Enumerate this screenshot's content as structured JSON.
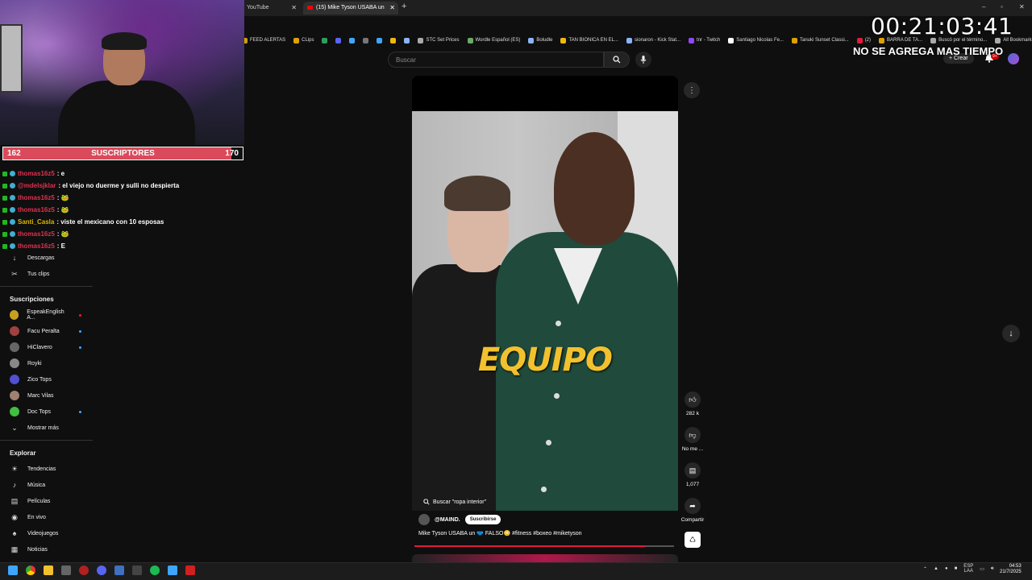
{
  "browser": {
    "tabs": [
      {
        "label": "YouTube"
      },
      {
        "label": "(15) Mike Tyson USABA un"
      }
    ],
    "bookmarks": [
      {
        "label": "FEED ALERTAS",
        "color": "#d0a000"
      },
      {
        "label": "CLips",
        "color": "#e0a000"
      },
      {
        "label": "",
        "color": "#2aa05a"
      },
      {
        "label": "",
        "color": "#5865f2"
      },
      {
        "label": "",
        "color": "#3ea6ff"
      },
      {
        "label": "",
        "color": "#777"
      },
      {
        "label": "",
        "color": "#3ea6ff"
      },
      {
        "label": "",
        "color": "#f0b90b"
      },
      {
        "label": "",
        "color": "#8ab4f8"
      },
      {
        "label": "STC Set Prices",
        "color": "#aaa"
      },
      {
        "label": "Wordle Español (ES)",
        "color": "#6aaa64"
      },
      {
        "label": "Boludle",
        "color": "#8ab4f8"
      },
      {
        "label": "TAN BIONICA EN EL...",
        "color": "#f0b90b"
      },
      {
        "label": "sionaron - Kick Stat...",
        "color": "#8ab4f8"
      },
      {
        "label": "tnr - Twitch",
        "color": "#9146ff"
      },
      {
        "label": "Santiago Nicolas Fe...",
        "color": "#fff"
      },
      {
        "label": "Tanuki Sunset Classi...",
        "color": "#e0a000"
      },
      {
        "label": "(2)",
        "color": "#e21b3c"
      },
      {
        "label": "BARRA DE TA...",
        "color": "#e0a000"
      },
      {
        "label": "Buscó por el término...",
        "color": "#aaa"
      },
      {
        "label": "All Bookmarks",
        "color": "#aaa"
      }
    ]
  },
  "overlay": {
    "timer": "00:21:03:41",
    "timer_note": "NO SE AGREGA MAS TIEMPO",
    "sub_bar": {
      "current": "162",
      "label": "SUSCRIPTORES",
      "goal": "170",
      "progress_fraction": 0.953
    },
    "chat": [
      {
        "user": "thomas16z5",
        "msg": ": e",
        "color": "red"
      },
      {
        "user": "@mdelsjklar",
        "msg": ": el viejo no duerme y sulli no despierta",
        "color": "red"
      },
      {
        "user": "thomas16z5",
        "msg": ": 🐸",
        "color": "red"
      },
      {
        "user": "thomas16z5",
        "msg": ": 🐸",
        "color": "red"
      },
      {
        "user": "Santi_Casla",
        "msg": ": viste el mexicano con 10 esposas",
        "color": "yellow"
      },
      {
        "user": "thomas16z5",
        "msg": ": 🐸",
        "color": "red"
      },
      {
        "user": "thomas16z5",
        "msg": ": E",
        "color": "red"
      }
    ]
  },
  "youtube": {
    "search_placeholder": "Buscar",
    "create_label": "Crear",
    "notif_count": "9+",
    "sidebar": {
      "top_items": [
        {
          "label": "Descargas",
          "icon": "↓"
        },
        {
          "label": "Tus clips",
          "icon": "✂"
        }
      ],
      "subs_heading": "Suscripciones",
      "subscriptions": [
        {
          "label": "EspeakEnglish A...",
          "color": "#c8a020",
          "live": true
        },
        {
          "label": "Facu Peralta",
          "color": "#a04040",
          "dot": true
        },
        {
          "label": "HiClavero",
          "color": "#666",
          "dot": true
        },
        {
          "label": "Royki",
          "color": "#888",
          "dot": false
        },
        {
          "label": "Zico Tops",
          "color": "#5050d0",
          "dot": false
        },
        {
          "label": "Marc Vilas",
          "color": "#a08070",
          "dot": false
        },
        {
          "label": "Doc Tops",
          "color": "#40c040",
          "dot": true
        }
      ],
      "show_more": "Mostrar más",
      "explore_heading": "Explorar",
      "explore": [
        {
          "label": "Tendencias",
          "icon": "☀"
        },
        {
          "label": "Música",
          "icon": "♪"
        },
        {
          "label": "Películas",
          "icon": "▤"
        },
        {
          "label": "En vivo",
          "icon": "◉"
        },
        {
          "label": "Videojuegos",
          "icon": "♠"
        },
        {
          "label": "Noticias",
          "icon": "▦"
        },
        {
          "label": "Deportes",
          "icon": "♣"
        }
      ]
    },
    "short": {
      "caption_overlay": "EQUIPO",
      "search_suggestion": "Buscar \"ropa interior\"",
      "channel": "@MAIND.",
      "subscribe_label": "Suscribirse",
      "title": "Mike Tyson USABA un 🩲 FALSO😳 #fitness #boxeo #miketyson",
      "progress_fraction": 0.89,
      "likes": "282 k",
      "dislike_label": "No me ...",
      "comments": "1,077",
      "share_label": "Compartir"
    }
  },
  "system": {
    "lang": "ESP",
    "lang_sub": "LAA",
    "time": "04:53",
    "date": "21/7/2025"
  }
}
